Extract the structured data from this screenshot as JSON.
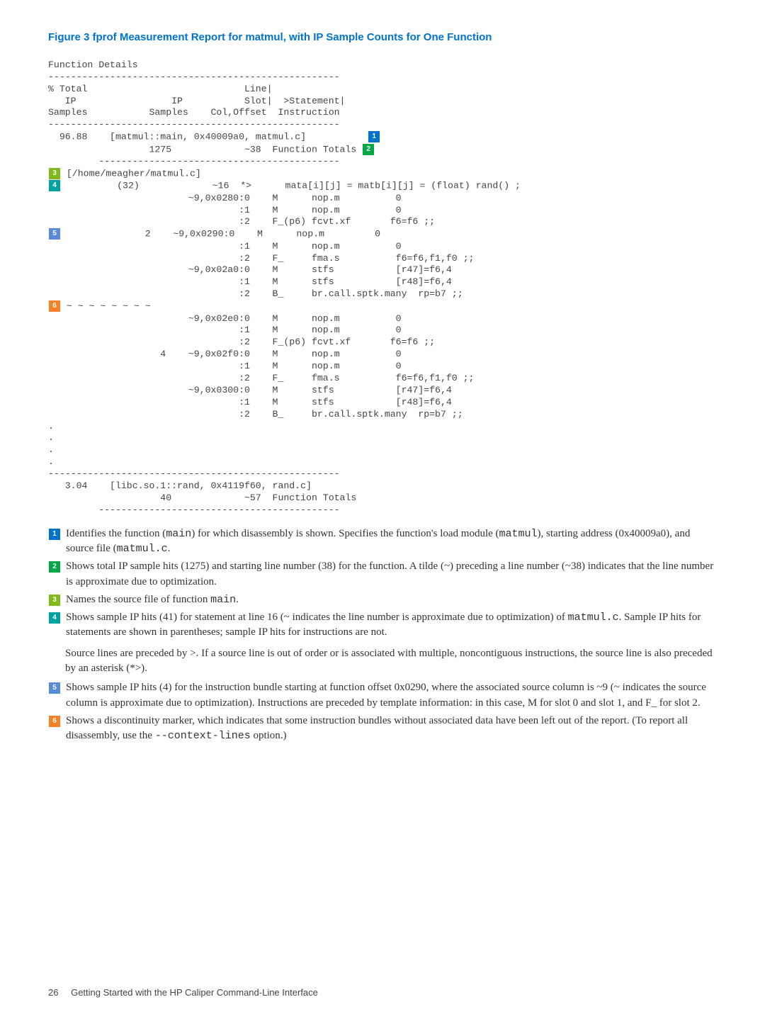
{
  "figure": {
    "title": "Figure 3 fprof Measurement Report for matmul, with IP Sample Counts for One Function"
  },
  "code": {
    "header": "Function Details\n----------------------------------------------------\n% Total                            Line|\n   IP                 IP           Slot|  >Statement|\nSamples           Samples    Col,Offset  Instruction\n----------------------------------------------------",
    "l_main_a": "  96.88    [matmul::main, 0x40009a0, matmul.c]           ",
    "l_main_b": "                  1275             ~38  Function Totals ",
    "sep1": "         -------------------------------------------",
    "l_src": " [/home/meagher/matmul.c]",
    "l_32": "          (32)             ~16  *>      mata[i][j] = matb[i][j] = (float) rand() ;",
    "block1": "                         ~9,0x0280:0    M      nop.m          0\n                                  :1    M      nop.m          0\n                                  :2    F_(p6) fcvt.xf       f6=f6 ;;",
    "l_bundle": "               2    ~9,0x0290:0    M      nop.m         0",
    "block2": "                                  :1    M      nop.m          0\n                                  :2    F_     fma.s          f6=f6,f1,f0 ;;\n                         ~9,0x02a0:0    M      stfs           [r47]=f6,4\n                                  :1    M      stfs           [r48]=f6,4\n                                  :2    B_     br.call.sptk.many  rp=b7 ;;",
    "l_tilde": " ~ ~ ~ ~ ~ ~ ~ ~",
    "block3": "                         ~9,0x02e0:0    M      nop.m          0\n                                  :1    M      nop.m          0\n                                  :2    F_(p6) fcvt.xf       f6=f6 ;;\n                    4    ~9,0x02f0:0    M      nop.m          0\n                                  :1    M      nop.m          0\n                                  :2    F_     fma.s          f6=f6,f1,f0 ;;\n                         ~9,0x0300:0    M      stfs           [r47]=f6,4\n                                  :1    M      stfs           [r48]=f6,4\n                                  :2    B_     br.call.sptk.many  rp=b7 ;;\n.\n.\n.\n.\n----------------------------------------------------\n   3.04    [libc.so.1::rand, 0x4119f60, rand.c]\n                    40             ~57  Function Totals\n         -------------------------------------------"
  },
  "notes": {
    "n1a": "Identifies the function (",
    "n1b": ") for which disassembly is shown. Specifies the function's load module (",
    "n1c": "), starting address (0x40009a0), and source file (",
    "n1d": ".",
    "m_main": "main",
    "m_matmul": "matmul",
    "m_matmulc": "matmul.c",
    "n2": "Shows total IP sample hits (1275) and starting line number (38) for the function. A tilde (~) preceding a line number (~38) indicates that the line number is approximate due to optimization.",
    "n3a": "Names the source file of function ",
    "n3b": ".",
    "n4a": "Shows sample IP hits (41) for statement at line 16 (~ indicates the line number is approximate due to optimization) of ",
    "n4b": ". Sample IP hits for statements are shown in parentheses; sample IP hits for instructions are not.",
    "n4sub": "Source lines are preceded by >. If a source line is out of order or is associated with multiple, noncontiguous instructions, the source line is also preceded by an asterisk (*>).",
    "n5": "Shows sample IP hits (4) for the instruction bundle starting at function offset 0x0290, where the associated source column is ~9 (~ indicates the source column is approximate due to optimization). Instructions are preceded by template information: in this case, M for slot 0 and slot 1, and F_ for slot 2.",
    "n6a": "Shows a discontinuity marker, which indicates that some instruction bundles without associated data have been left out of the report. (To report all disassembly, use the ",
    "n6b": " option.)",
    "m_context": "--context-lines"
  },
  "footer": {
    "page": "26",
    "section": "Getting Started with the HP Caliper Command-Line Interface"
  }
}
